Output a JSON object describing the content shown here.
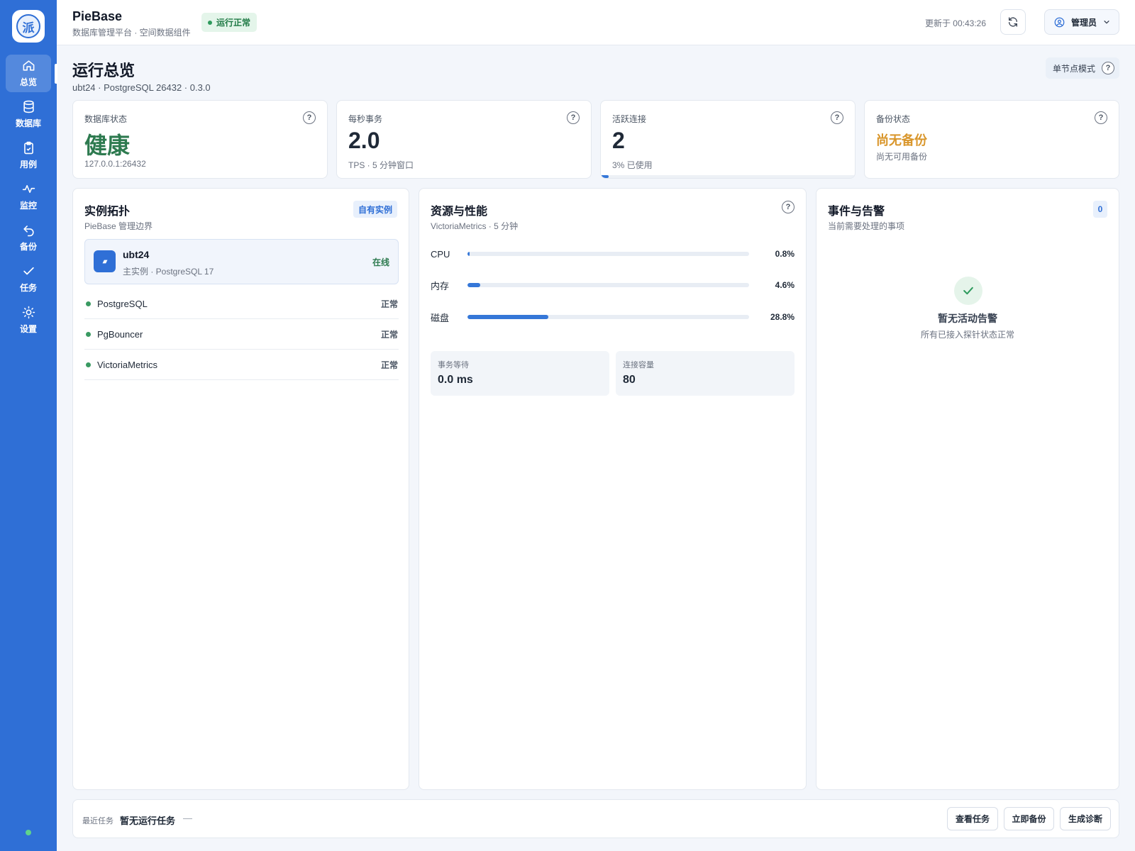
{
  "app": {
    "logo_glyph": "派",
    "name": "PieBase",
    "subtitle": "数据库管理平台 · 空间数据组件",
    "run_status": "运行正常"
  },
  "sidebar": {
    "items": [
      {
        "label": "总览",
        "icon": "home-icon",
        "active": true
      },
      {
        "label": "数据库",
        "icon": "database-icon"
      },
      {
        "label": "用例",
        "icon": "clipboard-check-icon"
      },
      {
        "label": "监控",
        "icon": "activity-icon"
      },
      {
        "label": "备份",
        "icon": "undo-icon"
      },
      {
        "label": "任务",
        "icon": "check-icon"
      },
      {
        "label": "设置",
        "icon": "sun-settings-icon"
      }
    ]
  },
  "header": {
    "updated": "更新于 00:43:26",
    "user": "管理员"
  },
  "page": {
    "title": "运行总览",
    "subtitle": "ubt24 · PostgreSQL 26432 · 0.3.0",
    "mode": "单节点模式"
  },
  "metrics": [
    {
      "label": "数据库状态",
      "value": "健康",
      "sub": "127.0.0.1:26432"
    },
    {
      "label": "每秒事务",
      "value": "2.0",
      "sub": "TPS · 5 分钟窗口"
    },
    {
      "label": "活跃连接",
      "value": "2",
      "sub": "3% 已使用",
      "usage_fraction": 0.03
    },
    {
      "label": "备份状态",
      "value": "尚无备份",
      "sub": "尚无可用备份"
    }
  ],
  "topology": {
    "title": "实例拓扑",
    "subtitle": "PieBase 管理边界",
    "tag": "自有实例",
    "instance": {
      "name": "ubt24",
      "role": "主实例 · PostgreSQL 17",
      "status": "在线"
    },
    "services": [
      {
        "name": "PostgreSQL",
        "state": "正常"
      },
      {
        "name": "PgBouncer",
        "state": "正常"
      },
      {
        "name": "VictoriaMetrics",
        "state": "正常"
      }
    ]
  },
  "resources": {
    "title": "资源与性能",
    "subtitle": "VictoriaMetrics · 5 分钟",
    "bars": [
      {
        "label": "CPU",
        "value": "0.8%",
        "fraction": 0.008
      },
      {
        "label": "内存",
        "value": "4.6%",
        "fraction": 0.046
      },
      {
        "label": "磁盘",
        "value": "28.8%",
        "fraction": 0.288
      }
    ],
    "stats": [
      {
        "label": "事务等待",
        "value": "0.0 ms"
      },
      {
        "label": "连接容量",
        "value": "80"
      }
    ]
  },
  "alerts": {
    "title": "事件与告警",
    "subtitle": "当前需要处理的事项",
    "count": "0",
    "empty_title": "暂无活动告警",
    "empty_sub": "所有已接入探针状态正常"
  },
  "footer": {
    "label": "最近任务",
    "value": "暂无运行任务",
    "dash": "—",
    "buttons": [
      "查看任务",
      "立即备份",
      "生成诊断"
    ]
  },
  "colors": {
    "brand": "#2f6fd6",
    "healthy": "#2d7a4f",
    "warning": "#d9962b",
    "online_dot": "#3a9a62"
  }
}
